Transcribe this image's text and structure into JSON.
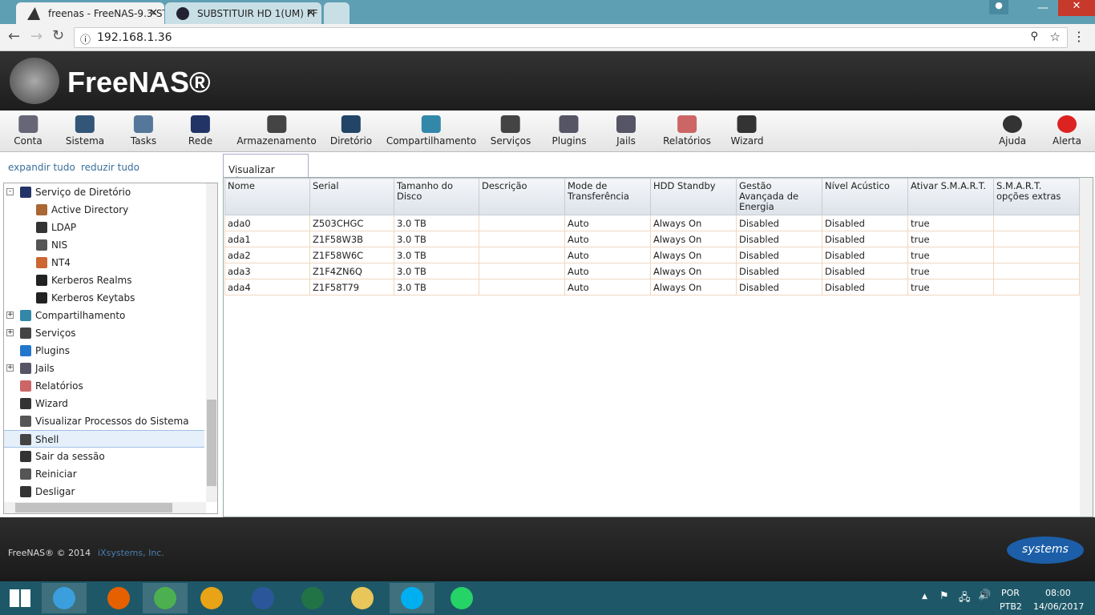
{
  "browser": {
    "tabs": [
      {
        "title": "freenas - FreeNAS-9.3-ST"
      },
      {
        "title": "SUBSTITUIR HD 1(UM) FF"
      }
    ],
    "url": "192.168.1.36"
  },
  "header": {
    "logo": "FreeNAS®"
  },
  "toolbar": {
    "items": [
      "Conta",
      "Sistema",
      "Tasks",
      "Rede",
      "Armazenamento",
      "Diretório",
      "Compartilhamento",
      "Serviços",
      "Plugins",
      "Jails",
      "Relatórios",
      "Wizard"
    ],
    "right": [
      "Ajuda",
      "Alerta"
    ]
  },
  "sidebar": {
    "expand": "expandir tudo",
    "collapse": "reduzir tudo",
    "items": [
      {
        "label": "Serviço de Diretório",
        "level": 0,
        "exp": "-"
      },
      {
        "label": "Active Directory",
        "level": 1
      },
      {
        "label": "LDAP",
        "level": 1
      },
      {
        "label": "NIS",
        "level": 1
      },
      {
        "label": "NT4",
        "level": 1
      },
      {
        "label": "Kerberos Realms",
        "level": 1
      },
      {
        "label": "Kerberos Keytabs",
        "level": 1
      },
      {
        "label": "Compartilhamento",
        "level": 0,
        "exp": "+"
      },
      {
        "label": "Serviços",
        "level": 0,
        "exp": "+"
      },
      {
        "label": "Plugins",
        "level": 0
      },
      {
        "label": "Jails",
        "level": 0,
        "exp": "+"
      },
      {
        "label": "Relatórios",
        "level": 0
      },
      {
        "label": "Wizard",
        "level": 0
      },
      {
        "label": "Visualizar Processos do Sistema",
        "level": 0
      },
      {
        "label": "Shell",
        "level": 0,
        "selected": true
      },
      {
        "label": "Sair da sessão",
        "level": 0
      },
      {
        "label": "Reiniciar",
        "level": 0
      },
      {
        "label": "Desligar",
        "level": 0
      }
    ]
  },
  "content": {
    "tab": "Visualizar Discos",
    "columns": [
      "Nome",
      "Serial",
      "Tamanho do Disco",
      "Descrição",
      "Mode de Transferência",
      "HDD Standby",
      "Gestão Avançada de Energia",
      "Nível Acústico",
      "Ativar S.M.A.R.T.",
      "S.M.A.R.T. opções extras"
    ],
    "rows": [
      [
        "ada0",
        "Z503CHGC",
        "3.0 TB",
        "",
        "Auto",
        "Always On",
        "Disabled",
        "Disabled",
        "true",
        ""
      ],
      [
        "ada1",
        "Z1F58W3B",
        "3.0 TB",
        "",
        "Auto",
        "Always On",
        "Disabled",
        "Disabled",
        "true",
        ""
      ],
      [
        "ada2",
        "Z1F58W6C",
        "3.0 TB",
        "",
        "Auto",
        "Always On",
        "Disabled",
        "Disabled",
        "true",
        ""
      ],
      [
        "ada3",
        "Z1F4ZN6Q",
        "3.0 TB",
        "",
        "Auto",
        "Always On",
        "Disabled",
        "Disabled",
        "true",
        ""
      ],
      [
        "ada4",
        "Z1F58T79",
        "3.0 TB",
        "",
        "Auto",
        "Always On",
        "Disabled",
        "Disabled",
        "true",
        ""
      ]
    ]
  },
  "footer": {
    "copyright": "FreeNAS® © 2014",
    "company": "iXsystems, Inc.",
    "logo": "iXsystems"
  },
  "taskbar": {
    "lang1": "POR",
    "lang2": "PTB2",
    "time": "08:00",
    "date": "14/06/2017"
  }
}
